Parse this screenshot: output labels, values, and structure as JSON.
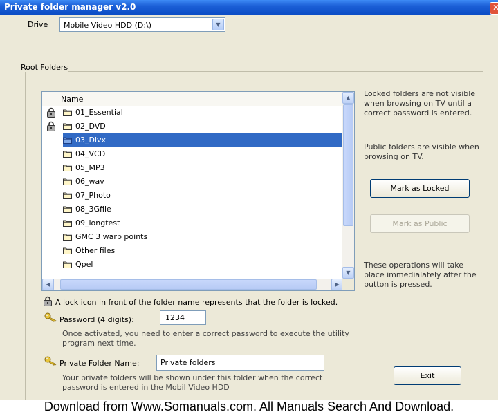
{
  "window": {
    "title": "Private folder manager v2.0",
    "close_glyph": "✕"
  },
  "drive": {
    "label": "Drive",
    "value": "Mobile Video HDD (D:\\)"
  },
  "root_folders": {
    "group_label": "Root Folders",
    "column_header": "Name",
    "folders": [
      {
        "name": "01_Essential",
        "locked": true,
        "selected": false
      },
      {
        "name": "02_DVD",
        "locked": true,
        "selected": false
      },
      {
        "name": "03_Divx",
        "locked": false,
        "selected": true
      },
      {
        "name": "04_VCD",
        "locked": false,
        "selected": false
      },
      {
        "name": "05_MP3",
        "locked": false,
        "selected": false
      },
      {
        "name": "06_wav",
        "locked": false,
        "selected": false
      },
      {
        "name": "07_Photo",
        "locked": false,
        "selected": false
      },
      {
        "name": "08_3Gfile",
        "locked": false,
        "selected": false
      },
      {
        "name": "09_longtest",
        "locked": false,
        "selected": false
      },
      {
        "name": "GMC 3 warp points",
        "locked": false,
        "selected": false
      },
      {
        "name": "Other files",
        "locked": false,
        "selected": false
      },
      {
        "name": "Qpel",
        "locked": false,
        "selected": false
      }
    ]
  },
  "info": {
    "locked_text": "Locked folders are not visible when browsing on TV until a correct password is entered.",
    "public_text": "Public folders are visible when browsing on TV.",
    "operations_text": "These operations will take place immedialately after the button is pressed."
  },
  "buttons": {
    "mark_locked": "Mark as Locked",
    "mark_public": "Mark as Public",
    "exit": "Exit"
  },
  "legend": {
    "lock_text": "A lock icon in front of the folder name represents that the folder is locked."
  },
  "password": {
    "label": "Password (4 digits):",
    "value": "1234",
    "note": "Once activated, you need to enter a correct password to execute the utility program next time."
  },
  "private_folder": {
    "label": "Private Folder Name:",
    "value": "Private folders",
    "note": "Your private folders will be shown under this folder when the correct password is entered in the Mobil Video HDD"
  },
  "footer": {
    "text": "Download from Www.Somanuals.com. All Manuals Search And Download."
  },
  "colors": {
    "title_bar": "#0a4bc4",
    "selection": "#316ac5",
    "dialog_bg": "#ece9d8"
  },
  "icons": [
    "lock-icon",
    "folder-icon",
    "key-icon",
    "close-icon",
    "chevron-down-icon"
  ]
}
